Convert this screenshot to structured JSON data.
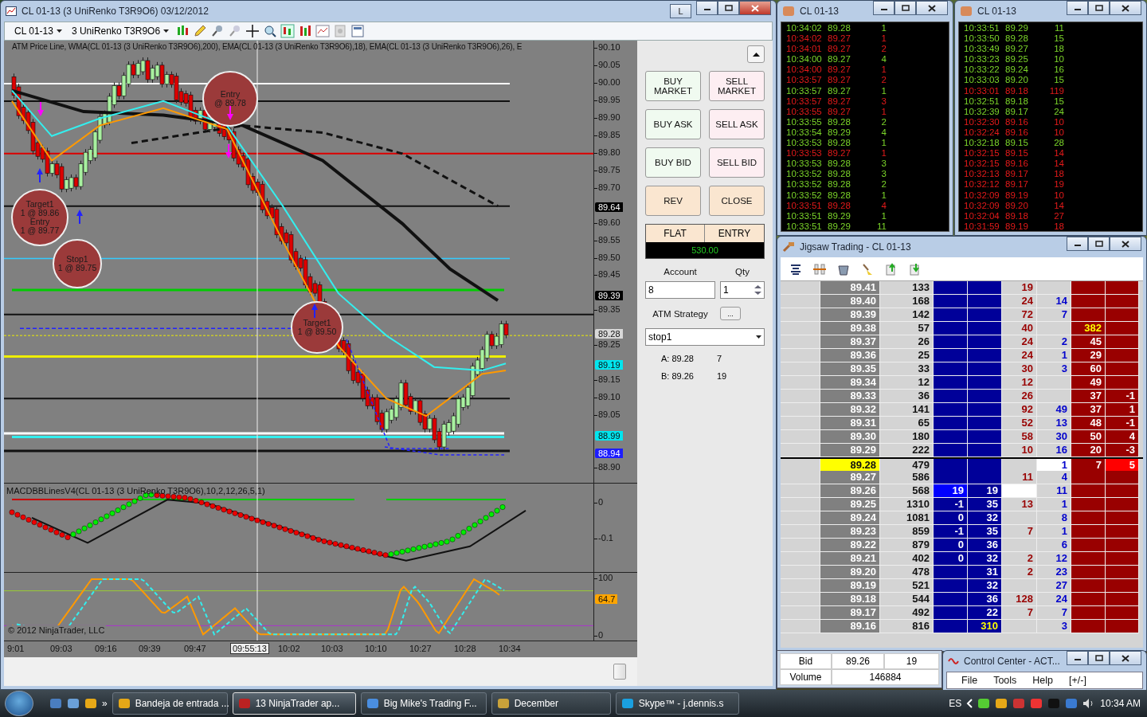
{
  "chart_window": {
    "title": "CL 01-13 (3 UniRenko T3R9O6)  03/12/2012",
    "title_button": "L",
    "toolbar": {
      "instrument": "CL 01-13",
      "bar_type": "3 UniRenko T3R9O6"
    },
    "indicator_label": "ATM Price Line, WMA(CL 01-13 (3 UniRenko T3R9O6),200), EMA(CL 01-13 (3 UniRenko T3R9O6),18), EMA(CL 01-13 (3 UniRenko T3R9O6),26), E",
    "price_axis": [
      "90.10",
      "90.05",
      "90.00",
      "89.95",
      "89.90",
      "89.85",
      "89.80",
      "89.75",
      "89.70",
      "89.60",
      "89.55",
      "89.50",
      "89.45",
      "89.35",
      "89.25",
      "89.15",
      "89.10",
      "89.05",
      "88.90"
    ],
    "price_markers": [
      {
        "label": "89.64",
        "color": "#000000"
      },
      {
        "label": "89.39",
        "color": "#000000"
      },
      {
        "label": "89.28",
        "color": "#d8d8d8"
      },
      {
        "label": "89.19",
        "color": "#00e5ee"
      },
      {
        "label": "88.99",
        "color": "#00e5ee"
      },
      {
        "label": "88.94",
        "color": "#1c1cff"
      }
    ],
    "annotations": [
      {
        "text": "Target1\n1 @ 89.86\nEntry\n1 @ 89.77"
      },
      {
        "text": "Stop1\n1 @ 89.75"
      },
      {
        "text": "Entry\n@ 89.78"
      },
      {
        "text": "Target1\n1 @ 89.50"
      }
    ],
    "macd": {
      "label": "MACDBBLinesV4(CL 01-13 (3 UniRenko T3R9O6),10,2,12,26,5,1)",
      "axis": [
        "0",
        "-0.1"
      ]
    },
    "stochastic": {
      "axis": [
        "100",
        "0"
      ],
      "marker": {
        "label": "64.7",
        "color": "#ffa500"
      }
    },
    "copyright": "© 2012 NinjaTrader, LLC",
    "time_axis": [
      "9:01",
      "09:03",
      "09:16",
      "09:39",
      "09:47",
      "10:02",
      "10:03",
      "10:10",
      "10:27",
      "10:28",
      "10:34"
    ],
    "crosshair_time": "09:55:13"
  },
  "order_panel": {
    "buttons": [
      {
        "label": "BUY\nMARKET",
        "kind": "buy"
      },
      {
        "label": "SELL\nMARKET",
        "kind": "sell"
      },
      {
        "label": "BUY ASK",
        "kind": "buy"
      },
      {
        "label": "SELL ASK",
        "kind": "sell"
      },
      {
        "label": "BUY BID",
        "kind": "buy"
      },
      {
        "label": "SELL BID",
        "kind": "sell"
      },
      {
        "label": "REV",
        "kind": "action"
      },
      {
        "label": "CLOSE",
        "kind": "action"
      }
    ],
    "position": "FLAT",
    "entry": "ENTRY",
    "pnl": "530.00",
    "account_label": "Account",
    "account_value": "8",
    "qty_label": "Qty",
    "qty": "1",
    "atm_label": "ATM Strategy",
    "atm_button": "...",
    "atm_value": "stop1",
    "quotes": [
      {
        "label": "A: 89.28",
        "size": "7"
      },
      {
        "label": "B: 89.26",
        "size": "19"
      }
    ]
  },
  "time_and_sales": [
    {
      "title": "CL 01-13",
      "rows": [
        {
          "time": "10:34:02",
          "price": "89.28",
          "size": "1",
          "buy": true
        },
        {
          "time": "10:34:02",
          "price": "89.27",
          "size": "1",
          "buy": false
        },
        {
          "time": "10:34:01",
          "price": "89.27",
          "size": "2",
          "buy": false
        },
        {
          "time": "10:34:00",
          "price": "89.27",
          "size": "4",
          "buy": true
        },
        {
          "time": "10:34:00",
          "price": "89.27",
          "size": "1",
          "buy": false
        },
        {
          "time": "10:33:57",
          "price": "89.27",
          "size": "2",
          "buy": false
        },
        {
          "time": "10:33:57",
          "price": "89.27",
          "size": "1",
          "buy": true
        },
        {
          "time": "10:33:57",
          "price": "89.27",
          "size": "3",
          "buy": false
        },
        {
          "time": "10:33:55",
          "price": "89.27",
          "size": "1",
          "buy": false
        },
        {
          "time": "10:33:55",
          "price": "89.28",
          "size": "2",
          "buy": true
        },
        {
          "time": "10:33:54",
          "price": "89.29",
          "size": "4",
          "buy": true
        },
        {
          "time": "10:33:53",
          "price": "89.28",
          "size": "1",
          "buy": true
        },
        {
          "time": "10:33:53",
          "price": "89.27",
          "size": "1",
          "buy": false
        },
        {
          "time": "10:33:53",
          "price": "89.28",
          "size": "3",
          "buy": true
        },
        {
          "time": "10:33:52",
          "price": "89.28",
          "size": "3",
          "buy": true
        },
        {
          "time": "10:33:52",
          "price": "89.28",
          "size": "2",
          "buy": true
        },
        {
          "time": "10:33:52",
          "price": "89.28",
          "size": "1",
          "buy": true
        },
        {
          "time": "10:33:51",
          "price": "89.28",
          "size": "4",
          "buy": false
        },
        {
          "time": "10:33:51",
          "price": "89.29",
          "size": "1",
          "buy": true
        },
        {
          "time": "10:33:51",
          "price": "89.29",
          "size": "11",
          "buy": true
        }
      ]
    },
    {
      "title": "CL 01-13",
      "rows": [
        {
          "time": "10:33:51",
          "price": "89.29",
          "size": "11",
          "buy": true
        },
        {
          "time": "10:33:50",
          "price": "89.28",
          "size": "15",
          "buy": true
        },
        {
          "time": "10:33:49",
          "price": "89.27",
          "size": "18",
          "buy": true
        },
        {
          "time": "10:33:23",
          "price": "89.25",
          "size": "10",
          "buy": true
        },
        {
          "time": "10:33:22",
          "price": "89.24",
          "size": "16",
          "buy": true
        },
        {
          "time": "10:33:03",
          "price": "89.20",
          "size": "15",
          "buy": true
        },
        {
          "time": "10:33:01",
          "price": "89.18",
          "size": "119",
          "buy": false
        },
        {
          "time": "10:32:51",
          "price": "89.18",
          "size": "15",
          "buy": true
        },
        {
          "time": "10:32:39",
          "price": "89.17",
          "size": "24",
          "buy": true
        },
        {
          "time": "10:32:30",
          "price": "89.16",
          "size": "10",
          "buy": false
        },
        {
          "time": "10:32:24",
          "price": "89.16",
          "size": "10",
          "buy": false
        },
        {
          "time": "10:32:18",
          "price": "89.15",
          "size": "28",
          "buy": true
        },
        {
          "time": "10:32:15",
          "price": "89.15",
          "size": "14",
          "buy": false
        },
        {
          "time": "10:32:15",
          "price": "89.16",
          "size": "14",
          "buy": false
        },
        {
          "time": "10:32:13",
          "price": "89.17",
          "size": "18",
          "buy": false
        },
        {
          "time": "10:32:12",
          "price": "89.17",
          "size": "19",
          "buy": false
        },
        {
          "time": "10:32:09",
          "price": "89.19",
          "size": "10",
          "buy": false
        },
        {
          "time": "10:32:09",
          "price": "89.20",
          "size": "14",
          "buy": false
        },
        {
          "time": "10:32:04",
          "price": "89.18",
          "size": "27",
          "buy": false
        },
        {
          "time": "10:31:59",
          "price": "89.19",
          "size": "18",
          "buy": false
        }
      ]
    }
  ],
  "dom": {
    "title": "Jigsaw Trading - CL 01-13",
    "rows": [
      {
        "price": "89.41",
        "volume": "133",
        "sold": "19"
      },
      {
        "price": "89.40",
        "volume": "168",
        "sold": "24",
        "bought": "14"
      },
      {
        "price": "89.39",
        "volume": "142",
        "sold": "72",
        "bought": "7"
      },
      {
        "price": "89.38",
        "volume": "57",
        "sold": "40",
        "ask_1": "382",
        "large_ask": true
      },
      {
        "price": "89.37",
        "volume": "26",
        "sold": "24",
        "bought": "2",
        "ask_1": "45"
      },
      {
        "price": "89.36",
        "volume": "25",
        "sold": "24",
        "bought": "1",
        "ask_1": "29"
      },
      {
        "price": "89.35",
        "volume": "33",
        "sold": "30",
        "bought": "3",
        "ask_1": "60"
      },
      {
        "price": "89.34",
        "volume": "12",
        "sold": "12",
        "ask_1": "49"
      },
      {
        "price": "89.33",
        "volume": "36",
        "sold": "26",
        "ask_1": "37",
        "ask_2": "-1"
      },
      {
        "price": "89.32",
        "volume": "141",
        "sold": "92",
        "bought": "49",
        "ask_1": "37",
        "ask_2": "1"
      },
      {
        "price": "89.31",
        "volume": "65",
        "sold": "52",
        "bought": "13",
        "ask_1": "48",
        "ask_2": "-1"
      },
      {
        "price": "89.30",
        "volume": "180",
        "sold": "58",
        "bought": "30",
        "ask_1": "50",
        "ask_2": "4"
      },
      {
        "price": "89.29",
        "volume": "222",
        "sold": "10",
        "bought": "16",
        "ask_1": "20",
        "ask_2": "-3"
      },
      {
        "price": "89.28",
        "volume": "479",
        "bought": "1",
        "ask_1": "7",
        "ask_2": "5",
        "last": true
      },
      {
        "price": "89.27",
        "volume": "586",
        "sold": "11",
        "bought": "4"
      },
      {
        "price": "89.26",
        "volume": "568",
        "bid_1": "19",
        "bid_2": "19",
        "bought": "11",
        "best_bid": true
      },
      {
        "price": "89.25",
        "volume": "1310",
        "bid_1": "-1",
        "bid_2": "35",
        "sold": "13",
        "bought": "1"
      },
      {
        "price": "89.24",
        "volume": "1081",
        "bid_1": "0",
        "bid_2": "32",
        "bought": "8"
      },
      {
        "price": "89.23",
        "volume": "859",
        "bid_1": "-1",
        "bid_2": "35",
        "sold": "7",
        "bought": "1"
      },
      {
        "price": "89.22",
        "volume": "879",
        "bid_1": "0",
        "bid_2": "36",
        "bought": "6"
      },
      {
        "price": "89.21",
        "volume": "402",
        "bid_1": "0",
        "bid_2": "32",
        "sold": "2",
        "bought": "12"
      },
      {
        "price": "89.20",
        "volume": "478",
        "bid_2": "31",
        "sold": "2",
        "bought": "23"
      },
      {
        "price": "89.19",
        "volume": "521",
        "bid_2": "32",
        "bought": "27"
      },
      {
        "price": "89.18",
        "volume": "544",
        "bid_2": "36",
        "sold": "128",
        "bought": "24"
      },
      {
        "price": "89.17",
        "volume": "492",
        "bid_2": "22",
        "sold": "7",
        "bought": "7"
      },
      {
        "price": "89.16",
        "volume": "816",
        "bid_2": "310",
        "bought": "3",
        "large_bid": true
      }
    ]
  },
  "bid_panel": {
    "bid_label": "Bid",
    "bid_price": "89.26",
    "bid_size": "19",
    "volume_label": "Volume",
    "volume": "146884"
  },
  "control_center": {
    "title": "Control Center - ACT...",
    "menu": [
      "File",
      "Tools",
      "Help",
      "[+/-]"
    ]
  },
  "taskbar": {
    "more": "»",
    "tasks": [
      {
        "label": "Bandeja de entrada ...",
        "kind": "mail",
        "selected": false
      },
      {
        "label": "13 NinjaTrader ap...",
        "kind": "ninja",
        "selected": true
      },
      {
        "label": "Big Mike's Trading F...",
        "kind": "browser",
        "selected": false
      },
      {
        "label": "December",
        "kind": "folder",
        "selected": false
      },
      {
        "label": "Skype™ - j.dennis.s",
        "kind": "skype",
        "selected": false
      }
    ],
    "language": "ES",
    "clock": "10:34 AM"
  }
}
